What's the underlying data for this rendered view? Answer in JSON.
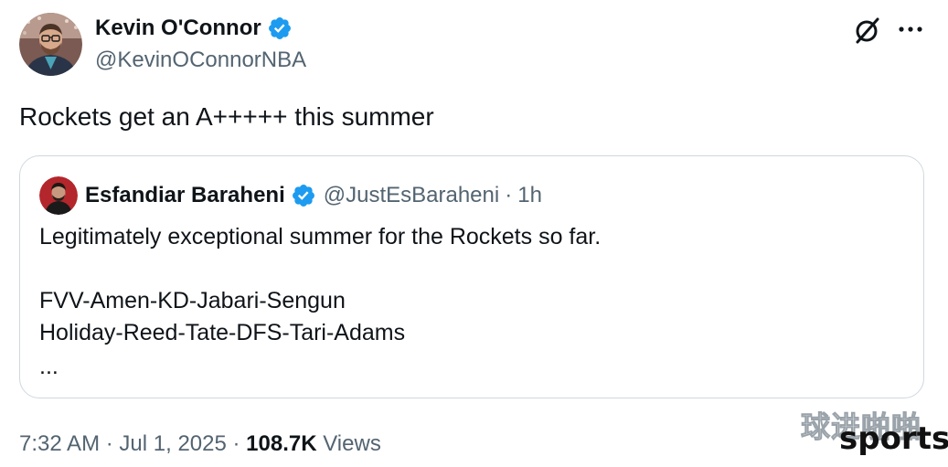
{
  "tweet": {
    "author": {
      "name": "Kevin O'Connor",
      "handle": "@KevinOConnorNBA",
      "verified": true
    },
    "text": "Rockets get an A+++++ this summer",
    "quoted": {
      "author": {
        "name": "Esfandiar Baraheni",
        "handle": "@JustEsBaraheni",
        "verified": true
      },
      "separator": "·",
      "time": "1h",
      "lines": [
        "Legitimately exceptional summer for the Rockets so far.",
        "FVV-Amen-KD-Jabari-Sengun",
        "Holiday-Reed-Tate-DFS-Tari-Adams",
        "..."
      ]
    },
    "footer": {
      "time": "7:32 AM",
      "separator": "·",
      "date": "Jul 1, 2025",
      "views_count": "108.7K",
      "views_label": "Views"
    }
  },
  "icons": {
    "verified": "verified-badge-icon",
    "grok": "grok-icon",
    "more": "more-options-icon"
  },
  "colors": {
    "verified_blue": "#1d9bf0",
    "text_primary": "#0f1419",
    "text_secondary": "#536471",
    "border": "#cfd9de"
  },
  "watermark": {
    "cn": "球进啪啪",
    "en": "sports"
  }
}
